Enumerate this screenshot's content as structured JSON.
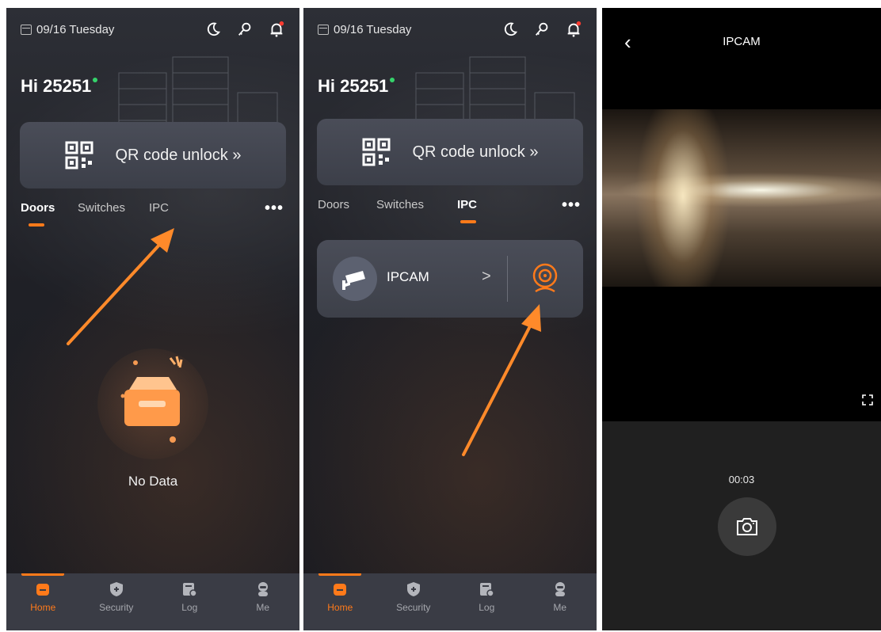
{
  "screens": [
    {
      "date": "09/16 Tuesday",
      "greeting": "Hi 25251",
      "qr_label": "QR code unlock »",
      "tabs": [
        "Doors",
        "Switches",
        "IPC"
      ],
      "active_tab": "Doors",
      "more": "•••",
      "empty_text": "No Data",
      "nav": [
        {
          "label": "Home",
          "icon": "home-icon"
        },
        {
          "label": "Security",
          "icon": "shield-icon"
        },
        {
          "label": "Log",
          "icon": "log-icon"
        },
        {
          "label": "Me",
          "icon": "user-icon"
        }
      ]
    },
    {
      "date": "09/16 Tuesday",
      "greeting": "Hi 25251",
      "qr_label": "QR code unlock »",
      "tabs": [
        "Doors",
        "Switches",
        "IPC"
      ],
      "active_tab": "IPC",
      "more": "•••",
      "device": {
        "name": "IPCAM",
        "chevron": ">"
      },
      "nav": [
        {
          "label": "Home",
          "icon": "home-icon"
        },
        {
          "label": "Security",
          "icon": "shield-icon"
        },
        {
          "label": "Log",
          "icon": "log-icon"
        },
        {
          "label": "Me",
          "icon": "user-icon"
        }
      ]
    }
  ],
  "viewer": {
    "back": "‹",
    "title": "IPCAM",
    "timer": "00:03"
  },
  "colors": {
    "accent": "#ff7a1a",
    "online": "#35d36b",
    "card": "#474a55",
    "nav_bg": "#3a3c45"
  }
}
